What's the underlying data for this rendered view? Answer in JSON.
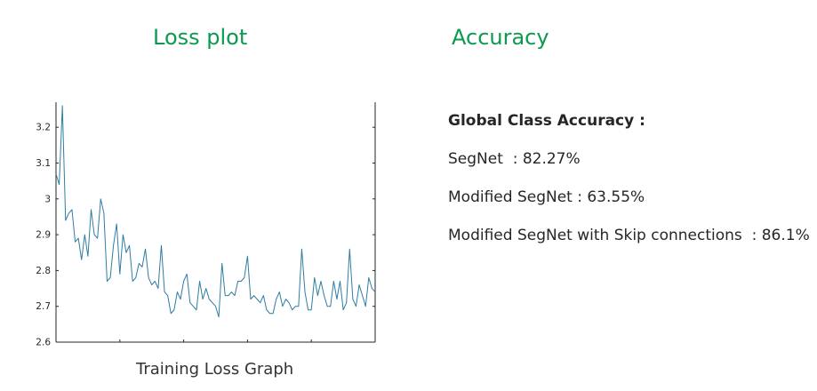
{
  "headings": {
    "loss": "Loss plot",
    "accuracy": "Accuracy"
  },
  "accuracy_panel": {
    "heading": "Global Class Accuracy :",
    "rows": [
      "SegNet  : 82.27%",
      "Modified SegNet : 63.55%",
      "Modified SegNet with Skip connections  : 86.1%"
    ]
  },
  "chart_data": {
    "type": "line",
    "title": "",
    "xlabel": "Training Loss Graph",
    "ylabel": "",
    "ylim": [
      2.6,
      3.27
    ],
    "yticks": [
      2.6,
      2.7,
      2.8,
      2.9,
      3.0,
      3.1,
      3.2
    ],
    "ytick_labels": [
      "2.6",
      "2.7",
      "2.8",
      "2.9",
      "3",
      "3.1",
      "3.2"
    ],
    "xtick_labels": [],
    "grid": false,
    "series": [
      {
        "name": "",
        "color": "#2e7da3",
        "values": [
          3.07,
          3.04,
          3.26,
          2.94,
          2.96,
          2.97,
          2.88,
          2.89,
          2.83,
          2.9,
          2.84,
          2.97,
          2.9,
          2.89,
          3.0,
          2.96,
          2.77,
          2.78,
          2.87,
          2.93,
          2.79,
          2.9,
          2.85,
          2.87,
          2.77,
          2.78,
          2.82,
          2.81,
          2.86,
          2.78,
          2.76,
          2.77,
          2.75,
          2.87,
          2.74,
          2.73,
          2.68,
          2.69,
          2.74,
          2.72,
          2.77,
          2.79,
          2.71,
          2.7,
          2.69,
          2.77,
          2.72,
          2.75,
          2.72,
          2.71,
          2.7,
          2.67,
          2.82,
          2.73,
          2.73,
          2.74,
          2.73,
          2.77,
          2.77,
          2.78,
          2.84,
          2.72,
          2.73,
          2.72,
          2.71,
          2.73,
          2.69,
          2.68,
          2.68,
          2.72,
          2.74,
          2.7,
          2.72,
          2.71,
          2.69,
          2.7,
          2.7,
          2.86,
          2.74,
          2.69,
          2.69,
          2.78,
          2.73,
          2.77,
          2.73,
          2.7,
          2.7,
          2.77,
          2.72,
          2.77,
          2.69,
          2.71,
          2.86,
          2.72,
          2.7,
          2.76,
          2.73,
          2.7,
          2.78,
          2.75,
          2.74
        ]
      }
    ]
  }
}
